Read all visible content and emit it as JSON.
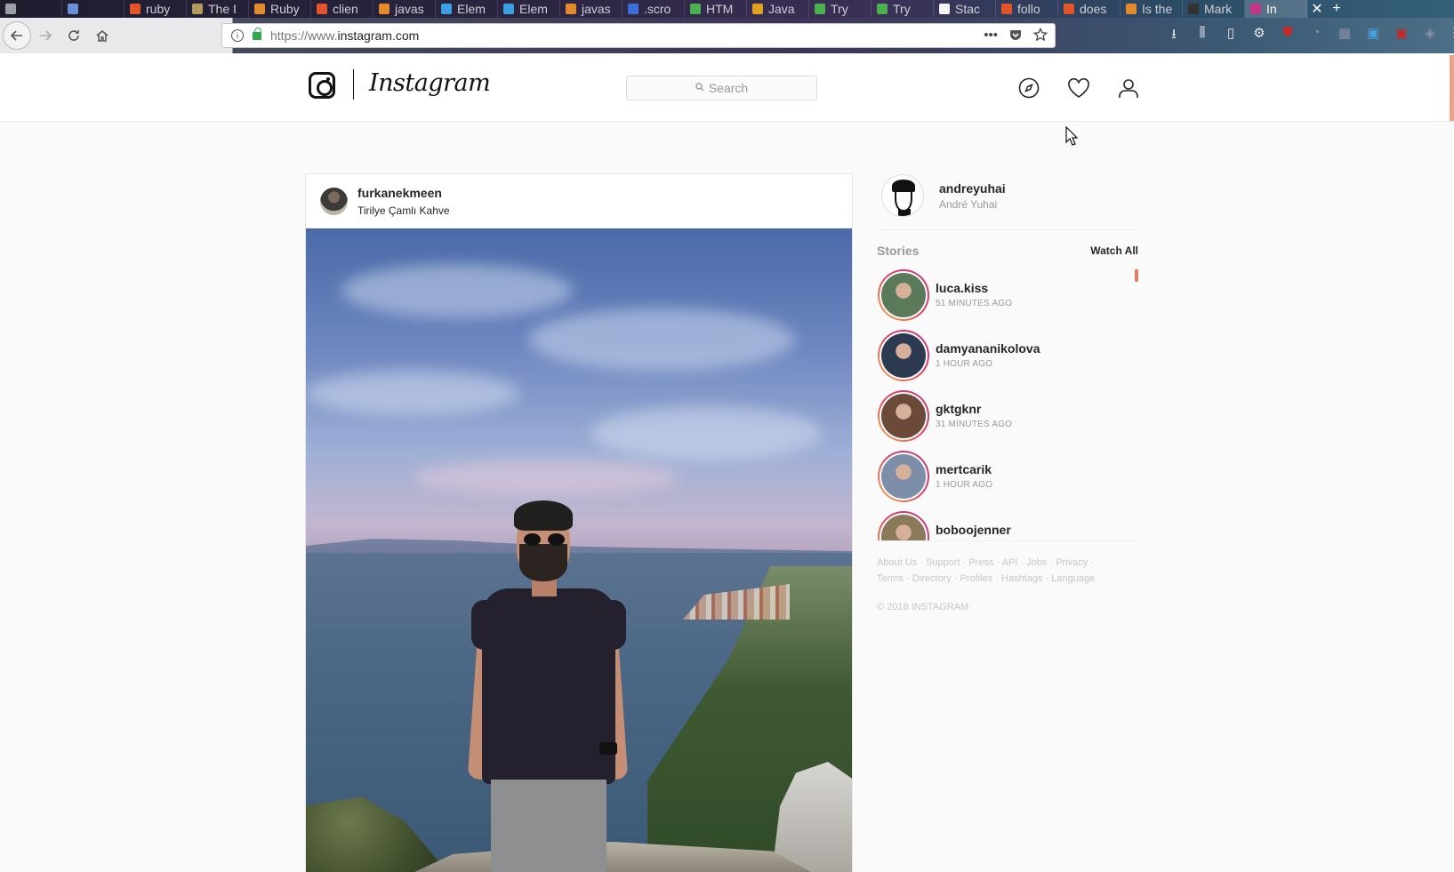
{
  "browser": {
    "tabs": [
      {
        "label": "",
        "favicon_color": "#9aa0a6"
      },
      {
        "label": "",
        "favicon_color": "#6a8fd6"
      },
      {
        "label": "ruby",
        "favicon_color": "#e2552b"
      },
      {
        "label": "The I",
        "favicon_color": "#b19a5a"
      },
      {
        "label": "Ruby",
        "favicon_color": "#e38b2c"
      },
      {
        "label": "clien",
        "favicon_color": "#e2552b"
      },
      {
        "label": "javas",
        "favicon_color": "#e38b2c"
      },
      {
        "label": "Elem",
        "favicon_color": "#3aa0e0"
      },
      {
        "label": "Elem",
        "favicon_color": "#3aa0e0"
      },
      {
        "label": "javas",
        "favicon_color": "#e38b2c"
      },
      {
        "label": ".scro",
        "favicon_color": "#3b6ed8"
      },
      {
        "label": "HTM",
        "favicon_color": "#4caf50"
      },
      {
        "label": "Java",
        "favicon_color": "#e0a020"
      },
      {
        "label": "Try",
        "favicon_color": "#4caf50"
      },
      {
        "label": "Try",
        "favicon_color": "#4caf50"
      },
      {
        "label": "Stac",
        "favicon_color": "#f4f4f4"
      },
      {
        "label": "follo",
        "favicon_color": "#e2552b"
      },
      {
        "label": "does",
        "favicon_color": "#e2552b"
      },
      {
        "label": "Is the",
        "favicon_color": "#e38b2c"
      },
      {
        "label": "Mark",
        "favicon_color": "#333333"
      },
      {
        "label": "In",
        "favicon_color": "#c13584",
        "active": true
      }
    ],
    "url_prefix": "https://www.",
    "url_domain": "instagram.com",
    "url_more": "•••",
    "new_tab": "+",
    "close_tab": "✕"
  },
  "header": {
    "wordmark": "Instagram",
    "search_placeholder": "Search",
    "icons": [
      "compass-icon",
      "heart-icon",
      "profile-icon"
    ]
  },
  "post": {
    "username": "furkanekmeen",
    "location": "Tirilye Çamlı Kahve"
  },
  "sidebar": {
    "me": {
      "username": "andreyuhai",
      "full_name": "André Yuhai"
    },
    "stories_title": "Stories",
    "watch_all": "Watch All",
    "stories": [
      {
        "username": "luca.kiss",
        "time": "51 MINUTES AGO",
        "photo_color": "#5a7a5a"
      },
      {
        "username": "damyananikolova",
        "time": "1 HOUR AGO",
        "photo_color": "#2d3b52"
      },
      {
        "username": "gktgknr",
        "time": "31 MINUTES AGO",
        "photo_color": "#6b4a3a"
      },
      {
        "username": "mertcarik",
        "time": "1 HOUR AGO",
        "photo_color": "#7d8ea8"
      },
      {
        "username": "boboojenner",
        "time": "",
        "photo_color": "#8a7a5a"
      }
    ],
    "footer_links": [
      "About Us",
      "Support",
      "Press",
      "API",
      "Jobs",
      "Privacy",
      "Terms",
      "Directory",
      "Profiles",
      "Hashtags",
      "Language"
    ],
    "copyright": "© 2018 INSTAGRAM"
  }
}
